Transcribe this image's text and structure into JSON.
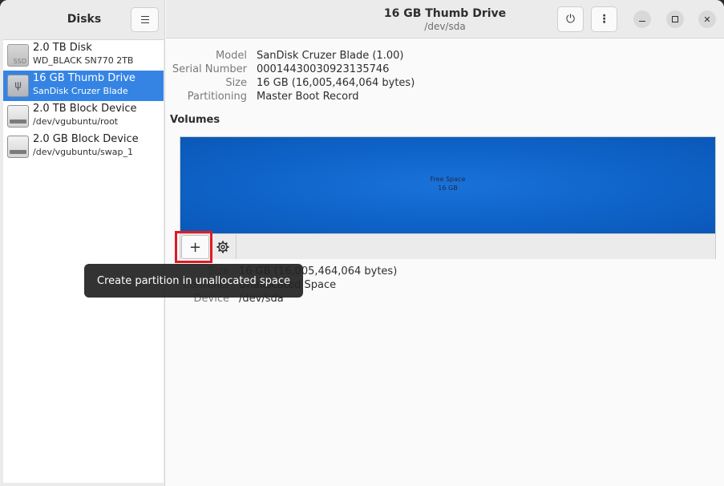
{
  "app": {
    "title": "Disks",
    "menu_icon": "hamburger-menu-icon"
  },
  "disks": [
    {
      "name": "2.0 TB Disk",
      "sub": "WD_BLACK SN770 2TB",
      "icon": "ssd-icon",
      "icon_text": "SSD",
      "selected": false
    },
    {
      "name": "16 GB Thumb Drive",
      "sub": "SanDisk Cruzer Blade",
      "icon": "usb-drive-icon",
      "icon_text": "ψ",
      "selected": true
    },
    {
      "name": "2.0 TB Block Device",
      "sub": "/dev/vgubuntu/root",
      "icon": "block-device-icon",
      "selected": false
    },
    {
      "name": "2.0 GB Block Device",
      "sub": "/dev/vgubuntu/swap_1",
      "icon": "block-device-icon",
      "selected": false
    }
  ],
  "header": {
    "title": "16 GB Thumb Drive",
    "subtitle": "/dev/sda",
    "power_icon": "power-icon",
    "power_glyph": "⏻",
    "more_icon": "more-options-icon",
    "more_glyph": "⋮",
    "close_glyph": "✕"
  },
  "drive": {
    "props": [
      {
        "key": "Model",
        "value": "SanDisk Cruzer Blade (1.00)"
      },
      {
        "key": "Serial Number",
        "value": "00014430030923135746"
      },
      {
        "key": "Size",
        "value": "16 GB (16,005,464,064 bytes)"
      },
      {
        "key": "Partitioning",
        "value": "Master Boot Record"
      }
    ]
  },
  "volumes": {
    "title": "Volumes",
    "segment_label": "Free Space",
    "segment_size": "16 GB",
    "add_glyph": "+",
    "props": [
      {
        "key": "Size",
        "value": "16 GB (16,005,464,064 bytes)"
      },
      {
        "key": "Contents",
        "value": "Unallocated Space"
      },
      {
        "key": "Device",
        "value": "/dev/sda"
      }
    ]
  },
  "tooltip": {
    "text": "Create partition in unallocated space"
  },
  "colors": {
    "accent": "#3584e4",
    "volume_fill": "#0f63c8",
    "highlight": "#e01b24"
  }
}
